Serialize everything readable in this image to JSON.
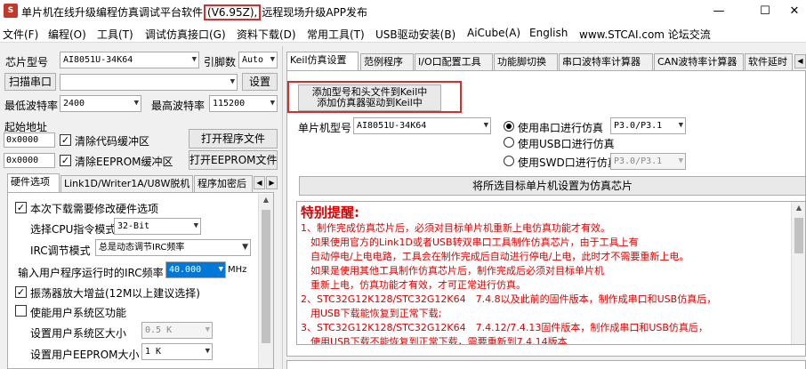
{
  "titlebar": {
    "app_title_prefix": "单片机在线升级编程仿真调试平台软件",
    "version": "(V6.95Z),",
    "app_title_suffix": "远程现场升级APP发布",
    "minimize": "—",
    "maximize": "☐",
    "close": "✕"
  },
  "menu": [
    "文件(F)",
    "编程(O)",
    "工具(T)",
    "调试仿真接口(G)",
    "资料下载(D)",
    "常用工具(T)",
    "USB驱动安装(B)",
    "AiCube(A)",
    "English",
    "www.STCAI.com 论坛交流"
  ],
  "left": {
    "chip_model_label": "芯片型号",
    "chip_model_value": "AI8051U-34K64",
    "pin_count_label": "引脚数",
    "pin_count_value": "Auto",
    "scan_port_button": "扫描串口",
    "port_value": "",
    "settings_button": "设置",
    "min_baud_label": "最低波特率",
    "min_baud_value": "2400",
    "max_baud_label": "最高波特率",
    "max_baud_value": "115200",
    "start_addr_label": "起始地址",
    "code_addr": "0x0000",
    "clear_code_buffer": "清除代码缓冲区",
    "open_program_button": "打开程序文件",
    "eeprom_addr": "0x0000",
    "clear_eeprom_buffer": "清除EEPROM缓冲区",
    "open_eeprom_button": "打开EEPROM文件",
    "tabs": [
      "硬件选项",
      "Link1D/Writer1A/U8W脱机",
      "程序加密后"
    ],
    "hw": {
      "modify_hw": "本次下载需要修改硬件选项",
      "cpu_mode_label": "选择CPU指令模式",
      "cpu_mode_value": "32-Bit",
      "irc_mode_label": "IRC调节模式",
      "irc_mode_value": "总是动态调节IRC频率",
      "irc_freq_label": "输入用户程序运行时的IRC频率",
      "irc_freq_value": "40.000",
      "irc_freq_unit": "MHz",
      "osc_gain": "振荡器放大增益(12M以上建议选择)",
      "enable_sys_area": "使能用户系统区功能",
      "sys_area_label": "设置用户系统区大小",
      "sys_area_value": "0.5 K",
      "eeprom_size_label": "设置用户EEPROM大小",
      "eeprom_size_value": "1  K"
    }
  },
  "right": {
    "tabs": [
      "Keil仿真设置",
      "范例程序",
      "I/O口配置工具",
      "功能脚切换",
      "串口波特率计算器",
      "CAN波特率计算器",
      "软件延时"
    ],
    "add_keil_line1": "添加型号和头文件到Keil中",
    "add_keil_line2": "添加仿真器驱动到Keil中",
    "mcu_label": "单片机型号",
    "mcu_value": "AI8051U-34K64",
    "use_uart": "使用串口进行仿真",
    "uart_value": "P3.0/P3.1",
    "use_usb": "使用USB口进行仿真",
    "use_swd": "使用SWD口进行仿真",
    "swd_value": "P3.0/P3.1",
    "set_as_emulator": "将所选目标单片机设置为仿真芯片",
    "notice_title": "特别提醒:",
    "notice_lines": [
      "1、制作完成仿真芯片后，必须对目标单片机重新上电仿真功能才有效。",
      "　如果使用官方的Link1D或者USB转双串口工具制作仿真芯片，由于工具上有",
      "　自动停电/上电电路，工具会在制作完成后自动进行停电/上电，此时才不需要重新上电。",
      "　如果是使用其他工具制作仿真芯片后，制作完成后必须对目标单片机",
      "　重新上电，仿真功能才有效，才可正常进行仿真。",
      "2、STC32G12K128/STC32G12K64　7.4.8以及此前的固件版本，制作成串口和USB仿真后，",
      "　用USB下载能恢复到正常下载;",
      "3、STC32G12K128/STC32G12K64　7.4.12/7.4.13固件版本，制作成串口和USB仿真后，",
      "　使用USB下载不能恢复到正常下载，需要重新到7.4.14版本"
    ]
  }
}
